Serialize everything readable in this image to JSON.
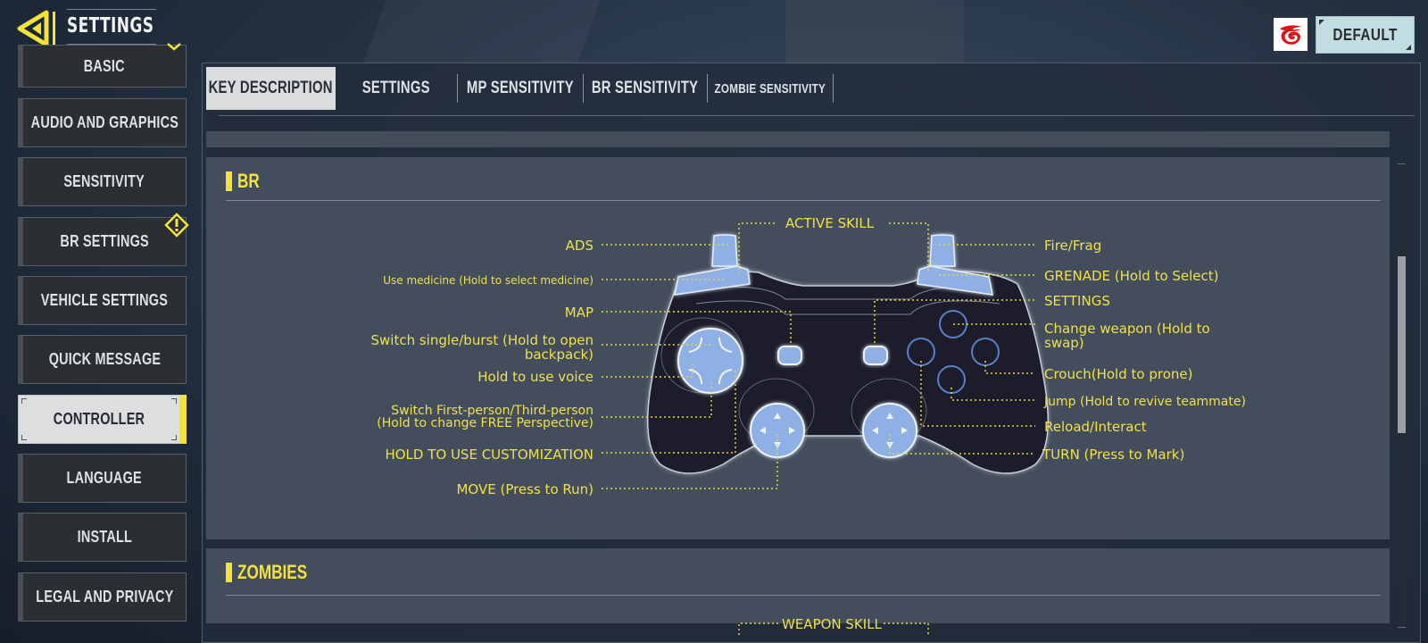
{
  "header": {
    "title": "SETTINGS",
    "back_icon": "back-arrow-icon",
    "brand_icon": "garena-logo",
    "default_button": "DEFAULT"
  },
  "sidebar": {
    "items": [
      {
        "label": "BASIC",
        "badge": "chevron-up-icon",
        "active": false
      },
      {
        "label": "AUDIO AND GRAPHICS",
        "active": false
      },
      {
        "label": "SENSITIVITY",
        "active": false
      },
      {
        "label": "BR SETTINGS",
        "badge": "warning-icon",
        "active": false
      },
      {
        "label": "VEHICLE SETTINGS",
        "active": false
      },
      {
        "label": "QUICK MESSAGE",
        "active": false
      },
      {
        "label": "CONTROLLER",
        "active": true
      },
      {
        "label": "LANGUAGE",
        "active": false
      },
      {
        "label": "INSTALL",
        "active": false
      },
      {
        "label": "LEGAL AND PRIVACY",
        "active": false
      }
    ]
  },
  "tabs": [
    {
      "label": "KEY DESCRIPTION",
      "active": true
    },
    {
      "label": "SETTINGS",
      "active": false
    },
    {
      "label": "MP SENSITIVITY",
      "active": false
    },
    {
      "label": "BR SENSITIVITY",
      "active": false
    },
    {
      "label": "ZOMBIE SENSITIVITY",
      "active": false
    }
  ],
  "sections": {
    "br": {
      "title": "BR",
      "top_label": "ACTIVE SKILL",
      "left_labels": [
        "ADS",
        "Use medicine (Hold to select medicine)",
        "MAP",
        "Switch single/burst (Hold to open backpack)",
        "Hold to use voice",
        "Switch First-person/Third-person (Hold to change FREE Perspective)",
        "HOLD TO USE CUSTOMIZATION",
        "MOVE (Press to Run)"
      ],
      "left_lines": {
        "l3a": "Switch single/burst (Hold to open",
        "l3b": "backpack)",
        "l5a": "Switch First-person/Third-person",
        "l5b": "(Hold to change FREE Perspective)"
      },
      "right_labels": [
        "Fire/Frag",
        "GRENADE (Hold to Select)",
        "SETTINGS",
        "Change weapon (Hold to swap)",
        "Crouch(Hold to prone)",
        "Jump (Hold to revive teammate)",
        "Reload/Interact",
        "TURN (Press to Mark)"
      ],
      "right_lines": {
        "r3a": "Change weapon (Hold to",
        "r3b": "swap)"
      }
    },
    "zombies": {
      "title": "ZOMBIES",
      "top_label": "WEAPON SKILL"
    }
  },
  "colors": {
    "accent_yellow": "#f3e23c",
    "label_yellow": "#f0e04a",
    "active_tab_bg": "#dadcde",
    "default_button_bg": "#c2dde2",
    "controller_button_blue": "#8fb0e4"
  },
  "scrollbar": {
    "position_fraction": 0.62
  }
}
